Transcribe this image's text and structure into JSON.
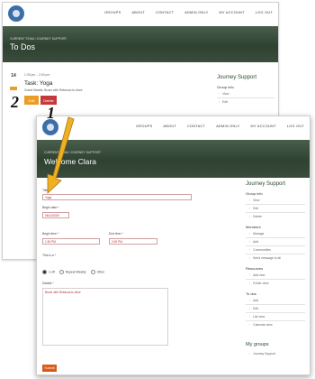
{
  "nav": {
    "links": [
      "GROUPS",
      "ABOUT",
      "CONTACT",
      "ADMIN ONLY",
      "MY ACCOUNT",
      "LOG OUT"
    ]
  },
  "back_page": {
    "breadcrumb": "CURRENT TEAM / JOURNEY SUPPORT",
    "title": "To Dos",
    "todo": {
      "day": "14",
      "time": "1:30 pm – 2:00 pm",
      "title": "Task: Yoga",
      "guest": "Guest Details: Bruce with Rebecca to drive",
      "edit_label": "Edit",
      "delete_label": "Delete"
    },
    "sidebar": {
      "title": "Journey Support",
      "section": "Group info",
      "items": [
        "View",
        "Edit"
      ]
    }
  },
  "front_page": {
    "breadcrumb": "CURRENT TEAM / JOURNEY SUPPORT",
    "title": "Welcome Clara",
    "form": {
      "title_label": "Title *",
      "title_value": "Yoga",
      "begin_date_label": "Begin date *",
      "begin_date_value": "06/14/2020",
      "begin_time_label": "Begin time *",
      "begin_time_value": "1:30 PM",
      "end_time_label": "End time *",
      "end_time_value": "2:00 PM",
      "repeat_label": "This is a *",
      "repeat_options": [
        "1-off",
        "Repeat Weekly",
        "Other"
      ],
      "details_label": "Details *",
      "details_value": "Bruce with Rebecca to drive",
      "submit_label": "Submit"
    },
    "sidebar": {
      "title": "Journey Support",
      "group_info": {
        "label": "Group info",
        "items": [
          "View",
          "Edit",
          "Delete"
        ]
      },
      "members": {
        "label": "Members",
        "items": [
          "Manage",
          "Add",
          "Communities",
          "Send message to all"
        ]
      },
      "resources": {
        "label": "Resources",
        "items": [
          "Add new",
          "Folder view"
        ]
      },
      "todos": {
        "label": "To dos",
        "items": [
          "Add",
          "Edit",
          "List view",
          "Calendar view"
        ]
      },
      "mygroups": {
        "label": "My groups",
        "items": [
          "Journey Support"
        ]
      }
    }
  },
  "annotations": {
    "step1": "1",
    "step2": "2"
  },
  "colors": {
    "accent_orange": "#e99c26",
    "arrow_yellow": "#f0b020",
    "delete_red": "#c43a3a",
    "hero_green": "#2f4232"
  }
}
